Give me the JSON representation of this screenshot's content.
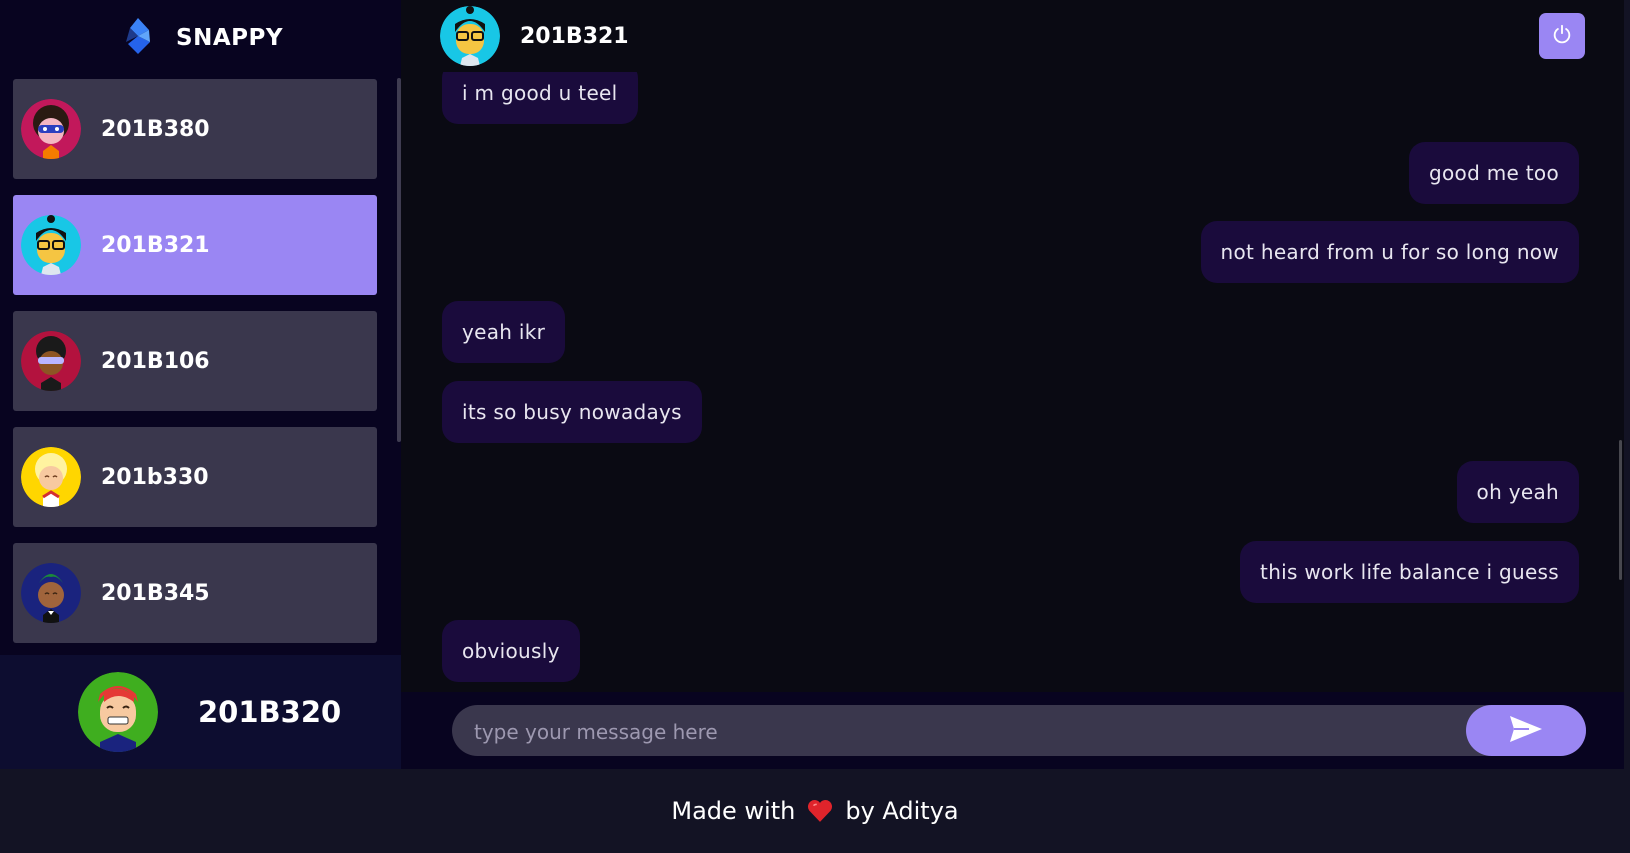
{
  "brand": {
    "name": "SNAPPY",
    "logo_icon": "snappy-logo-icon"
  },
  "contacts": [
    {
      "name": "201B380",
      "avatar": "avatar-pink-masked",
      "selected": false
    },
    {
      "name": "201B321",
      "avatar": "avatar-cyan-glasses",
      "selected": true
    },
    {
      "name": "201B106",
      "avatar": "avatar-red-sunglasses",
      "selected": false
    },
    {
      "name": "201b330",
      "avatar": "avatar-yellow-blonde",
      "selected": false
    },
    {
      "name": "201B345",
      "avatar": "avatar-navy-palm",
      "selected": false
    }
  ],
  "current_user": {
    "name": "201B320",
    "avatar": "avatar-green-redhair"
  },
  "chat": {
    "contact_name": "201B321",
    "logout_icon": "power-icon",
    "messages": [
      {
        "text": "i m good u teel",
        "sender": "received"
      },
      {
        "text": "good me too",
        "sender": "sent"
      },
      {
        "text": "not heard from u for so long now",
        "sender": "sent"
      },
      {
        "text": "yeah ikr",
        "sender": "received"
      },
      {
        "text": "its so busy nowadays",
        "sender": "received"
      },
      {
        "text": "oh yeah",
        "sender": "sent"
      },
      {
        "text": "this work life balance i guess",
        "sender": "sent"
      },
      {
        "text": "obviously",
        "sender": "received"
      }
    ],
    "input_placeholder": "type your message here",
    "send_icon": "send-arrow-icon"
  },
  "footer": {
    "prefix": "Made with",
    "heart_icon": "heart-icon",
    "suffix": "by Aditya"
  },
  "colors": {
    "accent": "#9a86f3",
    "bubble": "#1a0b3c",
    "sidebar": "#080420",
    "current_user_bg": "#0d0d30",
    "chat_bg": "#0a0a13",
    "page_bg": "#131324"
  }
}
